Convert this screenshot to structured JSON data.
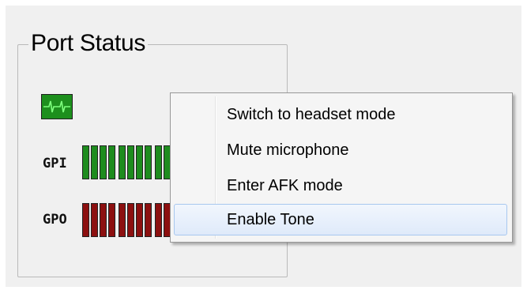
{
  "group": {
    "title": "Port Status"
  },
  "status_icon": {
    "name": "signal-wave-icon",
    "color": "#1d8f1d"
  },
  "ports": {
    "gpi": {
      "label": "GPI",
      "color": "#1e8c1e"
    },
    "gpo": {
      "label": "GPO",
      "color": "#8c1010"
    }
  },
  "context_menu": {
    "items": [
      {
        "label": "Switch to headset mode"
      },
      {
        "label": "Mute microphone"
      },
      {
        "label": "Enter AFK mode"
      },
      {
        "label": "Enable Tone",
        "highlighted": true
      }
    ]
  }
}
